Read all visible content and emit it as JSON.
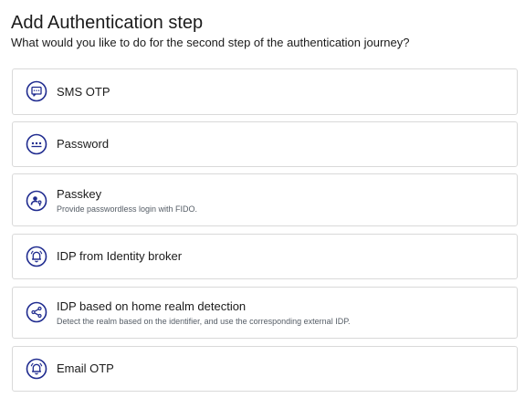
{
  "header": {
    "title": "Add Authentication step",
    "subtitle": "What would you like to do for the second step of the authentication journey?"
  },
  "colors": {
    "icon": "#1f2b8f",
    "border": "#d9d9d9"
  },
  "options": [
    {
      "label": "SMS OTP",
      "description": "",
      "icon": "message-icon"
    },
    {
      "label": "Password",
      "description": "",
      "icon": "password-dots-icon"
    },
    {
      "label": "Passkey",
      "description": "Provide passwordless login with FIDO.",
      "icon": "passkey-icon"
    },
    {
      "label": "IDP from Identity broker",
      "description": "",
      "icon": "bell-icon"
    },
    {
      "label": "IDP based on home realm detection",
      "description": "Detect the realm based on the identifier, and use the corresponding external IDP.",
      "icon": "share-icon"
    },
    {
      "label": "Email OTP",
      "description": "",
      "icon": "bell-icon"
    }
  ]
}
